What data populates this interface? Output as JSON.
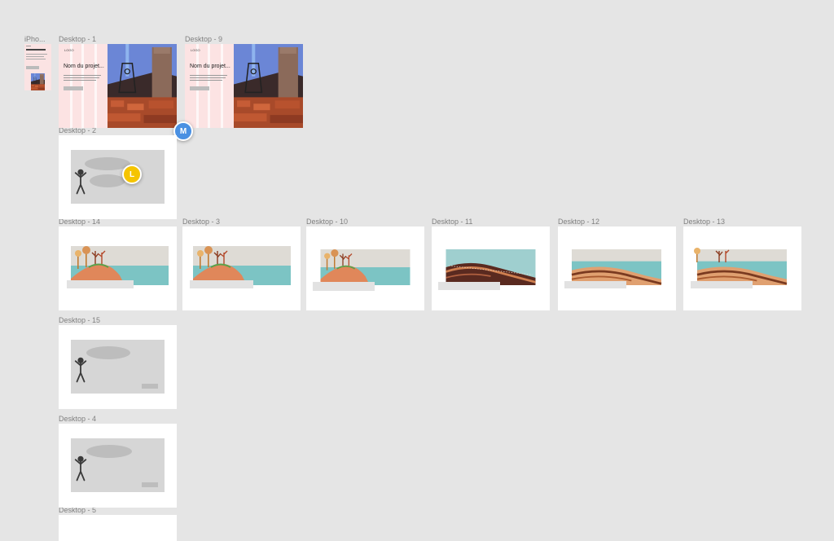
{
  "frames": [
    {
      "label": "iPho..."
    },
    {
      "label": "Desktop - 1"
    },
    {
      "label": "Desktop - 9"
    },
    {
      "label": "Desktop - 2"
    },
    {
      "label": "Desktop - 14"
    },
    {
      "label": "Desktop - 3"
    },
    {
      "label": "Desktop - 10"
    },
    {
      "label": "Desktop - 11"
    },
    {
      "label": "Desktop - 12"
    },
    {
      "label": "Desktop - 13"
    },
    {
      "label": "Desktop - 15"
    },
    {
      "label": "Desktop - 4"
    },
    {
      "label": "Desktop - 5"
    }
  ],
  "hero": {
    "logo": "LOGO",
    "title": "Nom du projet..."
  },
  "avatars": {
    "m": "M",
    "l": "L"
  },
  "colors": {
    "canvas": "#e5e5e5",
    "avatar_m": "#4a90e2",
    "avatar_l": "#f5c400",
    "sea": "#7cc4c4",
    "sand": "#e0875a"
  }
}
